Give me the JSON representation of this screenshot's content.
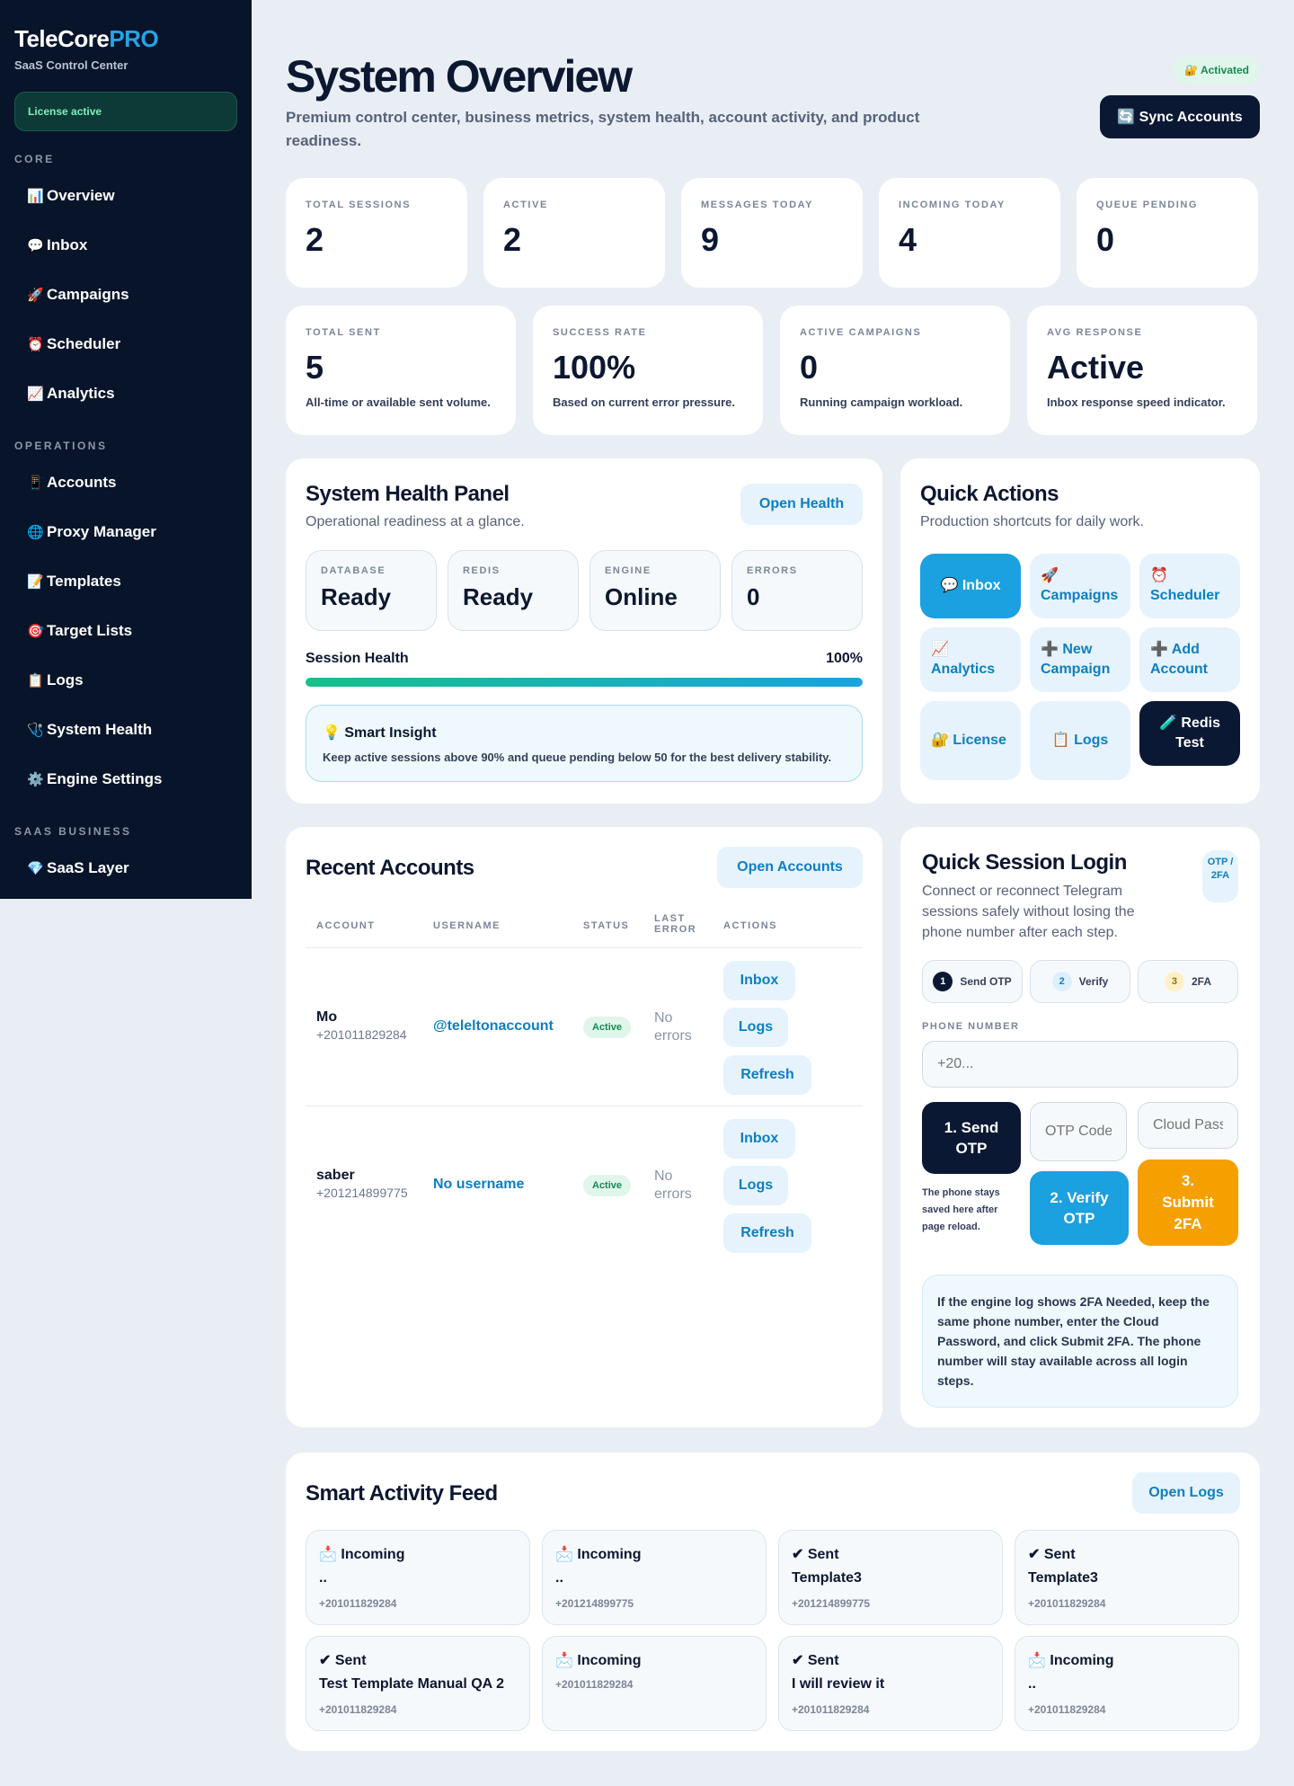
{
  "brand": {
    "name": "TeleCore",
    "suffix": "PRO",
    "subtitle": "SaaS Control Center",
    "license": "License active"
  },
  "sidebar": {
    "sections": [
      {
        "label": "CORE",
        "items": [
          {
            "icon": "📊",
            "label": "Overview"
          },
          {
            "icon": "💬",
            "label": "Inbox"
          },
          {
            "icon": "🚀",
            "label": "Campaigns"
          },
          {
            "icon": "⏰",
            "label": "Scheduler"
          },
          {
            "icon": "📈",
            "label": "Analytics"
          }
        ]
      },
      {
        "label": "OPERATIONS",
        "items": [
          {
            "icon": "📱",
            "label": "Accounts"
          },
          {
            "icon": "🌐",
            "label": "Proxy Manager"
          },
          {
            "icon": "📝",
            "label": "Templates"
          },
          {
            "icon": "🎯",
            "label": "Target Lists"
          },
          {
            "icon": "📋",
            "label": "Logs"
          },
          {
            "icon": "🩺",
            "label": "System Health"
          },
          {
            "icon": "⚙️",
            "label": "Engine Settings"
          }
        ]
      },
      {
        "label": "SAAS BUSINESS",
        "items": [
          {
            "icon": "💎",
            "label": "SaaS Layer"
          }
        ]
      }
    ]
  },
  "header": {
    "title": "System Overview",
    "subtitle": "Premium control center, business metrics, system health, account activity, and product readiness.",
    "activated": "🔐 Activated",
    "sync_label": "🔄 Sync Accounts"
  },
  "stats_row1": [
    {
      "label": "TOTAL SESSIONS",
      "value": "2"
    },
    {
      "label": "ACTIVE",
      "value": "2"
    },
    {
      "label": "MESSAGES TODAY",
      "value": "9"
    },
    {
      "label": "INCOMING TODAY",
      "value": "4"
    },
    {
      "label": "QUEUE PENDING",
      "value": "0"
    }
  ],
  "stats_row2": [
    {
      "label": "TOTAL SENT",
      "value": "5",
      "note": "All-time or available sent volume."
    },
    {
      "label": "SUCCESS RATE",
      "value": "100%",
      "note": "Based on current error pressure."
    },
    {
      "label": "ACTIVE CAMPAIGNS",
      "value": "0",
      "note": "Running campaign workload."
    },
    {
      "label": "AVG RESPONSE",
      "value": "Active",
      "note": "Inbox response speed indicator."
    }
  ],
  "health": {
    "title": "System Health Panel",
    "subtitle": "Operational readiness at a glance.",
    "open_label": "Open Health",
    "boxes": [
      {
        "label": "DATABASE",
        "value": "Ready"
      },
      {
        "label": "REDIS",
        "value": "Ready"
      },
      {
        "label": "ENGINE",
        "value": "Online"
      },
      {
        "label": "ERRORS",
        "value": "0"
      }
    ],
    "session_label": "Session Health",
    "session_value": "100%",
    "session_fraction": 1.0,
    "insight_title": "💡 Smart Insight",
    "insight_text": "Keep active sessions above 90% and queue pending below 50 for the best delivery stability."
  },
  "quick_actions": {
    "title": "Quick Actions",
    "subtitle": "Production shortcuts for daily work.",
    "buttons": [
      {
        "label": "💬 Inbox"
      },
      {
        "label": "🚀 Campaigns"
      },
      {
        "label": "⏰ Scheduler"
      },
      {
        "label": "📈 Analytics"
      },
      {
        "label": "➕ New Campaign"
      },
      {
        "label": "➕ Add Account"
      },
      {
        "label": "🔐 License"
      },
      {
        "label": "📋 Logs"
      },
      {
        "label": "🧪 Redis Test"
      }
    ]
  },
  "accounts": {
    "title": "Recent Accounts",
    "open_label": "Open Accounts",
    "columns": [
      "ACCOUNT",
      "USERNAME",
      "STATUS",
      "LAST ERROR",
      "ACTIONS"
    ],
    "rows": [
      {
        "name": "Mo",
        "phone": "+201011829284",
        "username": "@teleltonaccount",
        "status": "Active",
        "error": "No errors"
      },
      {
        "name": "saber",
        "phone": "+201214899775",
        "username": "No username",
        "status": "Active",
        "error": "No errors"
      }
    ],
    "actions": [
      "Inbox",
      "Logs",
      "Refresh"
    ]
  },
  "session_login": {
    "title": "Quick Session Login",
    "badge": "OTP / 2FA",
    "subtitle": "Connect or reconnect Telegram sessions safely without losing the phone number after each step.",
    "steps": [
      {
        "num": "1",
        "label": "Send OTP"
      },
      {
        "num": "2",
        "label": "Verify"
      },
      {
        "num": "3",
        "label": "2FA"
      }
    ],
    "phone_label": "PHONE NUMBER",
    "phone_placeholder": "+20...",
    "otp_placeholder": "OTP Code",
    "cloud_placeholder": "Cloud Password",
    "send_label": "1. Send OTP",
    "verify_label": "2. Verify OTP",
    "submit_label": "3. Submit 2FA",
    "note": "The phone stays saved here after page reload.",
    "help": "If the engine log shows 2FA Needed, keep the same phone number, enter the Cloud Password, and click Submit 2FA. The phone number will stay available across all login steps."
  },
  "feed": {
    "title": "Smart Activity Feed",
    "open_label": "Open Logs",
    "items": [
      {
        "title": "📩 Incoming",
        "body": "..",
        "phone": "+201011829284"
      },
      {
        "title": "📩 Incoming",
        "body": "..",
        "phone": "+201214899775"
      },
      {
        "title": "✔ Sent",
        "body": "Template3",
        "phone": "+201214899775"
      },
      {
        "title": "✔ Sent",
        "body": "Template3",
        "phone": "+201011829284"
      },
      {
        "title": "✔ Sent",
        "body": "Test Template Manual QA 2",
        "phone": "+201011829284"
      },
      {
        "title": "📩 Incoming",
        "body": "",
        "phone": "+201011829284"
      },
      {
        "title": "✔ Sent",
        "body": "I will review it",
        "phone": "+201011829284"
      },
      {
        "title": "📩 Incoming",
        "body": "..",
        "phone": "+201011829284"
      }
    ]
  }
}
